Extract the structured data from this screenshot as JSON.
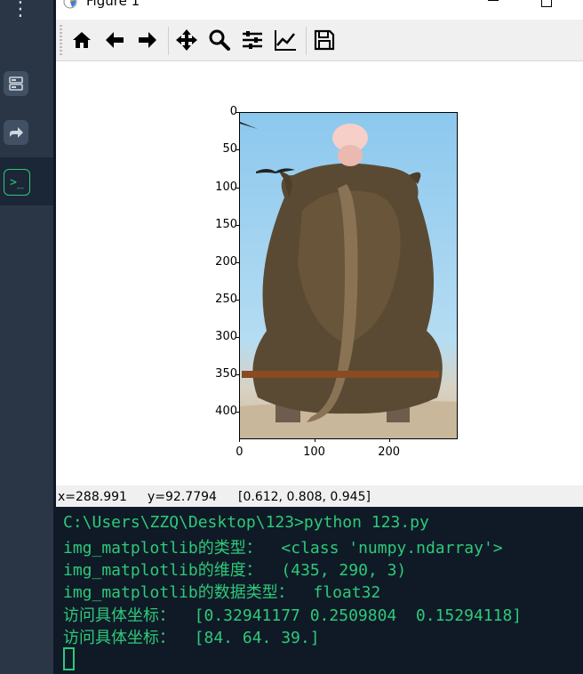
{
  "window": {
    "title": "Figure 1"
  },
  "toolbar": {
    "buttons": [
      {
        "name": "home-button",
        "icon": "home-icon"
      },
      {
        "name": "back-button",
        "icon": "arrow-left-icon"
      },
      {
        "name": "forward-button",
        "icon": "arrow-right-icon"
      },
      {
        "name": "pan-button",
        "icon": "move-icon"
      },
      {
        "name": "zoom-button",
        "icon": "magnifier-icon"
      },
      {
        "name": "subplots-button",
        "icon": "sliders-icon"
      },
      {
        "name": "customize-button",
        "icon": "line-chart-icon"
      },
      {
        "name": "save-button",
        "icon": "floppy-disk-icon"
      }
    ]
  },
  "plot": {
    "y_ticks": [
      "0",
      "50",
      "100",
      "150",
      "200",
      "250",
      "300",
      "350",
      "400"
    ],
    "x_ticks": [
      "0",
      "100",
      "200"
    ]
  },
  "status": {
    "x": "x=288.991",
    "y": "y=92.7794",
    "value": "[0.612, 0.808, 0.945]"
  },
  "terminal": {
    "lines": [
      "C:\\Users\\ZZQ\\Desktop\\123>python 123.py",
      "img_matplotlib的类型：  <class 'numpy.ndarray'>",
      "img_matplotlib的维度：  (435, 290, 3)",
      "img_matplotlib的数据类型：  float32",
      "访问具体坐标：  [0.32941177 0.2509804  0.15294118]",
      "访问具体坐标：  [84. 64. 39.]"
    ]
  },
  "colors": {
    "terminal_text": "#2ec97a",
    "terminal_bg": "#0f1a26",
    "sidebar_bg": "#2a3645"
  }
}
